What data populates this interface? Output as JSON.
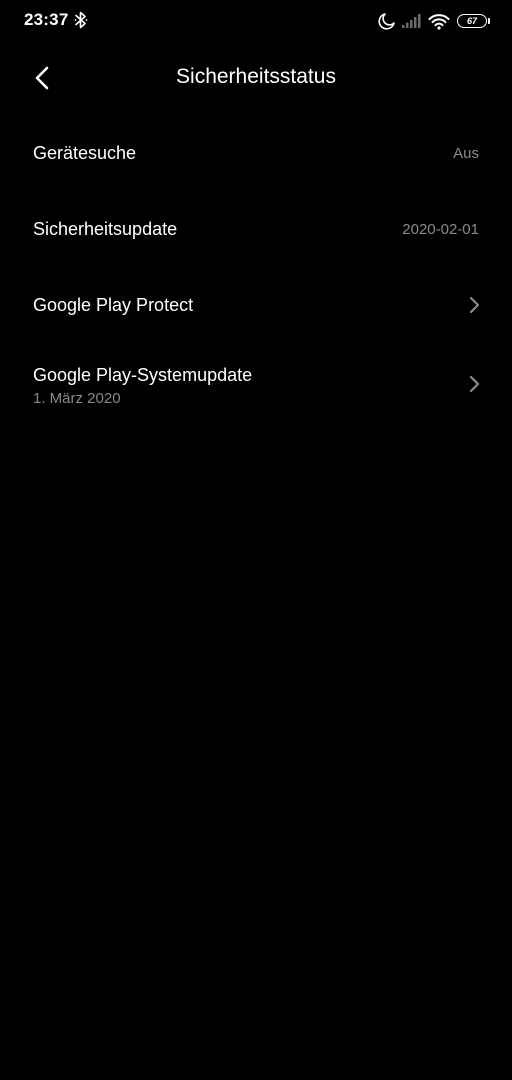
{
  "status_bar": {
    "time": "23:37",
    "battery_level": "67"
  },
  "header": {
    "title": "Sicherheitsstatus"
  },
  "items": [
    {
      "label": "Gerätesuche",
      "value": "Aus"
    },
    {
      "label": "Sicherheitsupdate",
      "value": "2020-02-01"
    },
    {
      "label": "Google Play Protect"
    },
    {
      "label": "Google Play-Systemupdate",
      "subtitle": "1. März 2020"
    }
  ],
  "colors": {
    "background": "#000000",
    "text_primary": "#ffffff",
    "text_secondary": "#8a8a8a"
  },
  "icons": [
    "bluetooth-icon",
    "moon-icon",
    "signal-icon",
    "wifi-icon",
    "battery-icon",
    "back-arrow-icon",
    "chevron-right-icon"
  ]
}
